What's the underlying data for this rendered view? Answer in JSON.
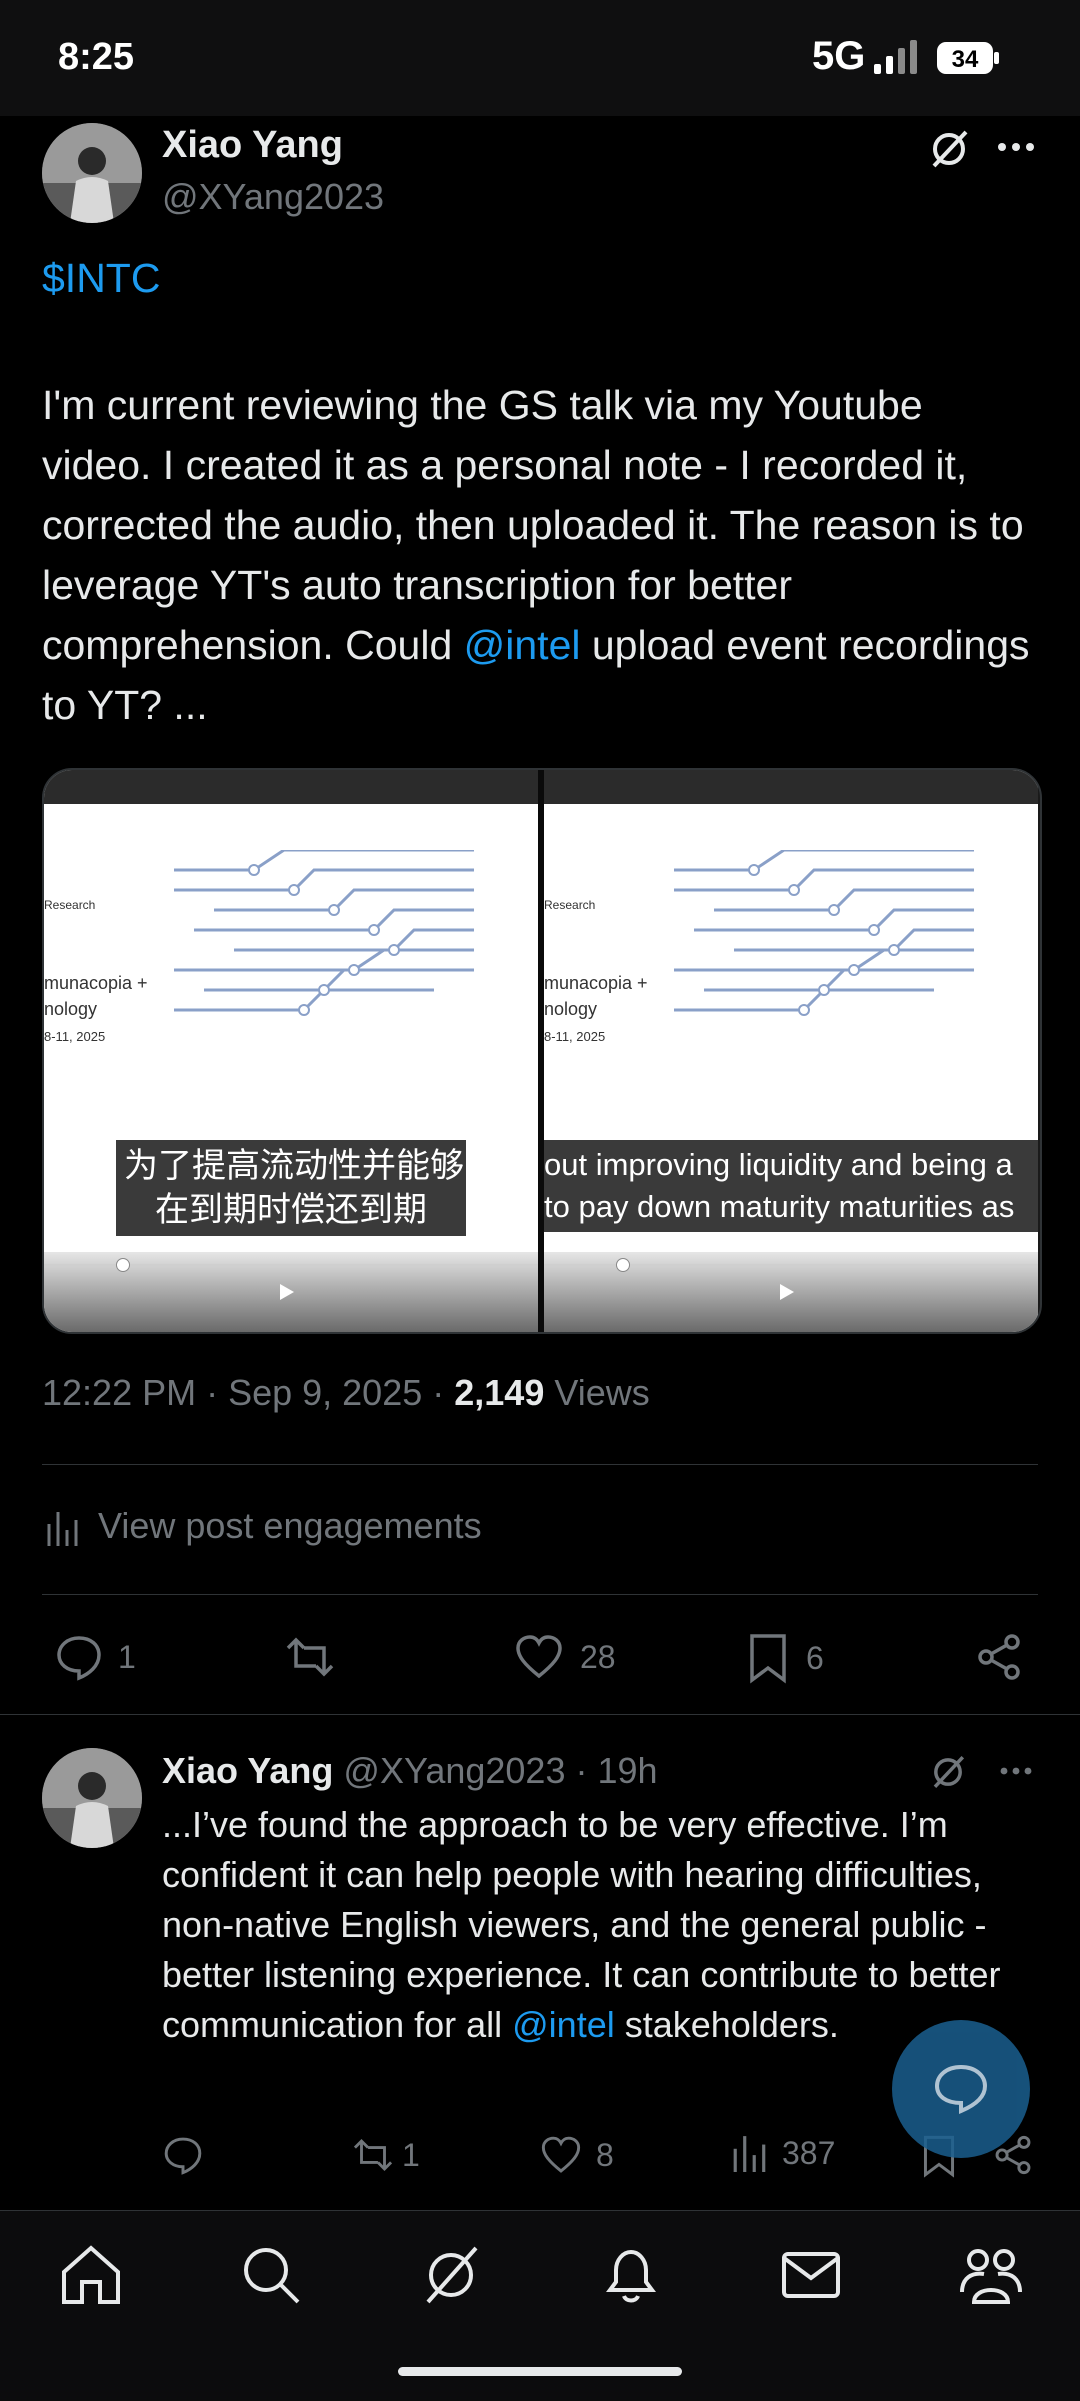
{
  "status_bar": {
    "time": "8:25",
    "network": "5G",
    "battery": "34"
  },
  "post": {
    "author_name": "Xiao Yang",
    "author_handle": "@XYang2023",
    "cashtag": "$INTC",
    "text_part1": "I'm current reviewing the GS talk via my Youtube video. I created it as a personal note - I recorded it, corrected the audio, then uploaded it. The reason is to leverage YT's auto transcription for better comprehension. Could ",
    "mention": "@intel",
    "text_part2": " upload event recordings to YT? ...",
    "media": {
      "left_caption_line1": "为了提高流动性并能够",
      "left_caption_line2": "在到期时偿还到期",
      "right_caption_line1": "out improving liquidity and being a",
      "right_caption_line2": "to pay down maturity maturities as",
      "slide_research": "Research",
      "slide_title_line1": "munacopia +",
      "slide_title_line2": "nology",
      "slide_date": "8-11, 2025"
    },
    "timestamp": "12:22 PM · Sep 9, 2025 · ",
    "views_count": "2,149",
    "views_label": " Views",
    "engagements_link": "View post engagements",
    "actions": {
      "replies": "1",
      "likes": "28",
      "bookmarks": "6"
    }
  },
  "reply": {
    "author_name": "Xiao Yang",
    "author_handle": "@XYang2023",
    "age": " · 19h",
    "text_part1": "...I’ve found the approach to be very effective. I’m confident it can help people with hearing difficulties, non-native English viewers, and the general public - better listening experience. It can contribute to better communication for all ",
    "mention": "@intel",
    "text_part2": " stakeholders.",
    "actions": {
      "reposts": "1",
      "likes": "8",
      "views": "387"
    }
  },
  "nav": [
    "home-icon",
    "search-icon",
    "grok-icon",
    "notifications-icon",
    "messages-icon",
    "communities-icon"
  ],
  "colors": {
    "accent": "#1d9bf0",
    "muted": "#71767b",
    "text": "#e7e9ea",
    "background": "#000000"
  }
}
